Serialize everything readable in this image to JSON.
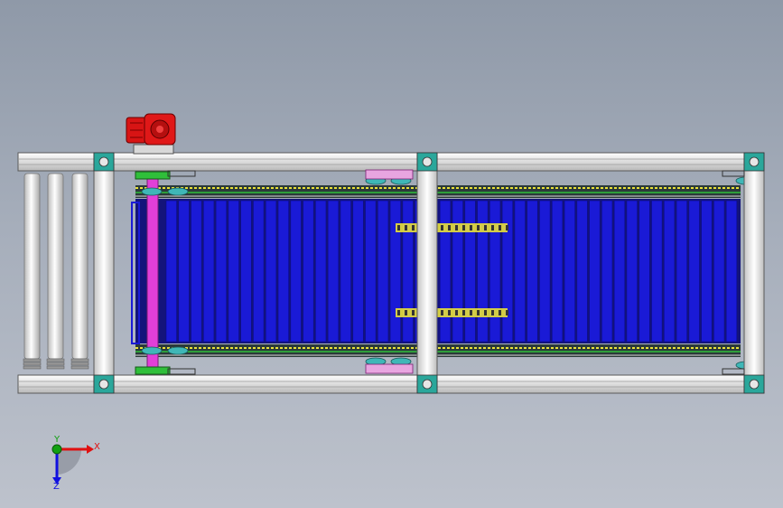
{
  "view": {
    "background_top": "#8f99a8",
    "background_bottom": "#bdc2cc"
  },
  "colors": {
    "frame": "#e6e6e6",
    "frame_edge": "#5a5a5a",
    "slat": "#1a1ad6",
    "slat_dark": "#0b0b8c",
    "chain_yellow": "#e8e03a",
    "chain_green": "#2fbf3a",
    "sprocket_teal": "#3fb7b7",
    "shaft_magenta": "#e23fd8",
    "motor_red": "#d81414",
    "roller": "#f4f4f4"
  },
  "icons": {
    "motor": "gear-motor-icon",
    "triad": "coordinate-triad-icon"
  },
  "triad": {
    "x_label": "X",
    "y_label": "Y",
    "z_label": "Z",
    "x_color": "#e01010",
    "y_color": "#10a010",
    "z_color": "#1010e0"
  },
  "conveyor": {
    "slat_count": 46,
    "roller_count": 3
  }
}
